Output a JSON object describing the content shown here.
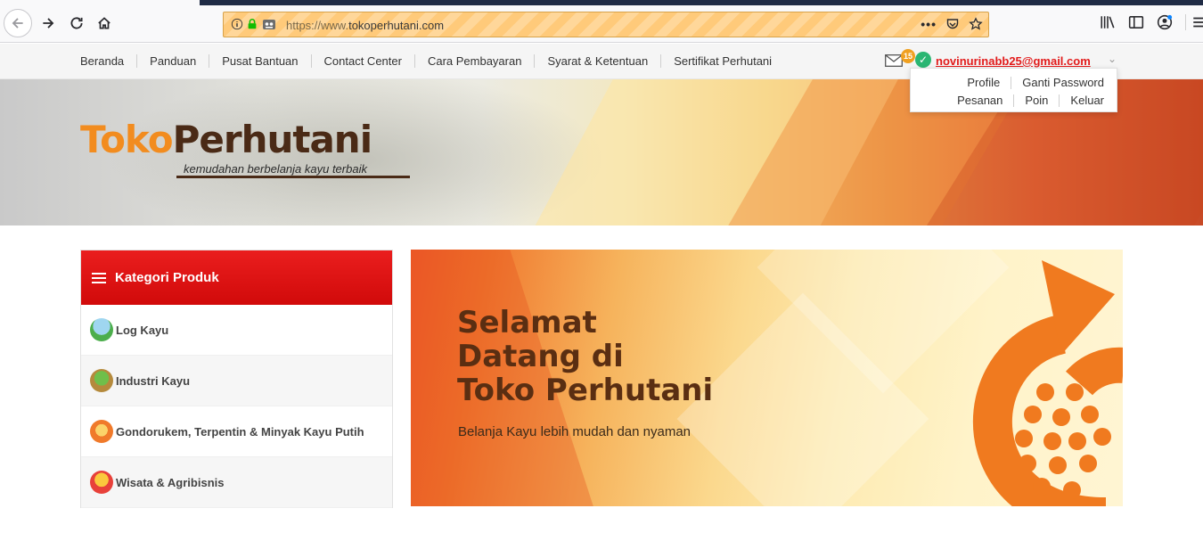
{
  "browser": {
    "url_protocol": "https://www.",
    "url_domain": "tokoperhutani.com"
  },
  "topnav": {
    "links": [
      "Beranda",
      "Panduan",
      "Pusat Bantuan",
      "Contact Center",
      "Cara Pembayaran",
      "Syarat & Ketentuan",
      "Sertifikat Perhutani"
    ],
    "notification_count": "15",
    "user_email": "novinurinabb25@gmail.com"
  },
  "user_menu": {
    "row1": [
      "Profile",
      "Ganti Password"
    ],
    "row2": [
      "Pesanan",
      "Poin",
      "Keluar"
    ]
  },
  "header": {
    "logo_part1": "Toko",
    "logo_part2": "Perhutani",
    "tagline": "kemudahan berbelanja kayu terbaik"
  },
  "sidebar": {
    "title": "Kategori Produk",
    "items": [
      {
        "label": "Log Kayu",
        "icon": "log-kayu-icon",
        "color": "#4cae4c"
      },
      {
        "label": "Industri Kayu",
        "icon": "industri-kayu-icon",
        "color": "#8bbf3f"
      },
      {
        "label": "Gondorukem, Terpentin & Minyak Kayu Putih",
        "icon": "gondorukem-icon",
        "color": "#f07a2a"
      },
      {
        "label": "Wisata & Agribisnis",
        "icon": "wisata-icon",
        "color": "#e8413a"
      }
    ]
  },
  "banner": {
    "title": "Selamat\nDatang di\nToko Perhutani",
    "subtitle": "Belanja Kayu lebih mudah dan nyaman"
  },
  "colors": {
    "accent_red": "#e21b1b",
    "brand_orange": "#f28c1f",
    "brand_brown": "#4a2a16"
  }
}
